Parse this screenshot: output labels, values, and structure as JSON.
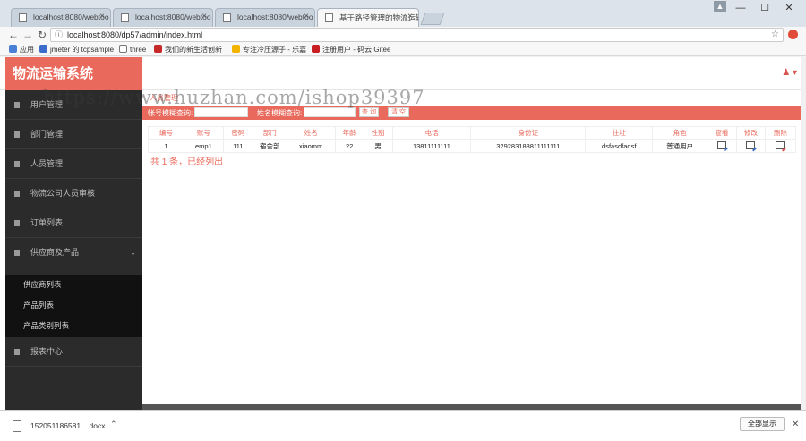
{
  "browser": {
    "tabs": [
      {
        "label": "localhost:8080/webtoo",
        "active": false
      },
      {
        "label": "localhost:8080/webtoo",
        "active": false
      },
      {
        "label": "localhost:8080/webtoo",
        "active": false
      },
      {
        "label": "基于路径管理的物流运输",
        "active": true
      }
    ],
    "url": "localhost:8080/dp57/admin/index.html",
    "bookmarks": [
      "应用",
      "jmeter 的 tcpsample",
      "three",
      "我们的新生活创新",
      "专注冷压源子 - 乐嘉",
      "注册用户 - 码云 Gitee"
    ],
    "controls": {
      "minimize": "—",
      "maximize": "☐",
      "close": "✕"
    }
  },
  "app": {
    "title": "物流运输系统",
    "watermark": "https://www.huzhan.com/ishop39397",
    "breadcrumb": "人员管理",
    "user_icon": "user-icon"
  },
  "sidebar": {
    "items": [
      {
        "label": "用户管理"
      },
      {
        "label": "部门管理"
      },
      {
        "label": "人员管理"
      },
      {
        "label": "物流公司人员审核"
      },
      {
        "label": "订单列表"
      },
      {
        "label": "供应商及产品"
      },
      {
        "label": "报表中心"
      }
    ],
    "subitems": [
      {
        "label": "供应商列表"
      },
      {
        "label": "产品列表"
      },
      {
        "label": "产品类别列表"
      }
    ]
  },
  "search": {
    "label1": "帐号模糊查询:",
    "label2": "姓名模糊查询:",
    "query_button": "查 询",
    "reset_button": "清 空"
  },
  "table": {
    "headers": [
      "编号",
      "账号",
      "密码",
      "部门",
      "姓名",
      "年龄",
      "性别",
      "电话",
      "身份证",
      "住址",
      "角色",
      "查看",
      "修改",
      "删除"
    ],
    "rows": [
      [
        "1",
        "emp1",
        "111",
        "宿舍部",
        "xiaomm",
        "22",
        "男",
        "13811111111",
        "329283188811111111",
        "dsfasdfadsf",
        "普通用户"
      ]
    ],
    "summary": "共 1 条，已经列出"
  },
  "download": {
    "filename": "152051186581....docx",
    "show_all": "全部显示"
  },
  "colors": {
    "accent": "#e96a5c",
    "sidebar_bg": "#2b2b2b",
    "subnav_bg": "#111111"
  }
}
